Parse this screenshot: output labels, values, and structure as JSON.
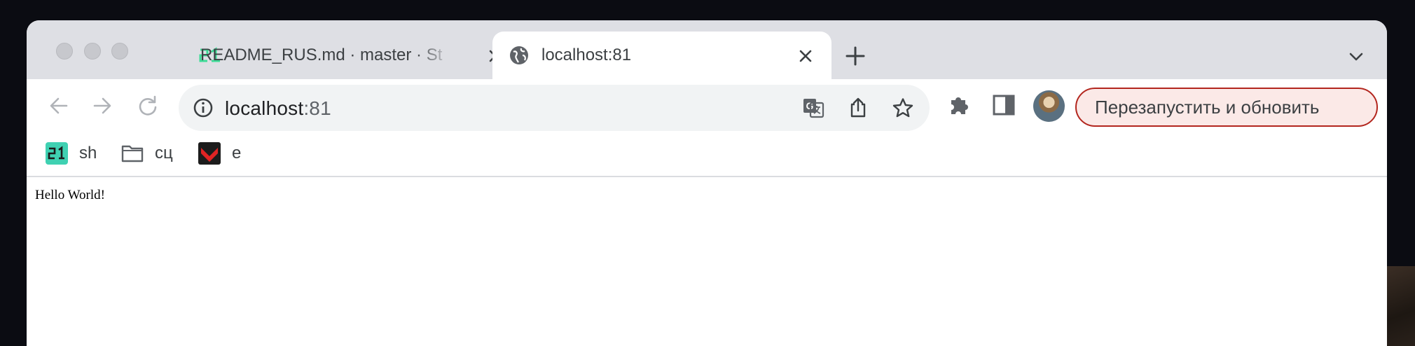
{
  "tabs": [
    {
      "title": "README_RUS.md · master · St",
      "favicon": "school21-icon",
      "close_icon": "close-icon",
      "active": false
    },
    {
      "title": "localhost:81",
      "favicon": "globe-icon",
      "close_icon": "close-icon",
      "active": true
    }
  ],
  "new_tab_icon": "plus-icon",
  "tab_search_icon": "chevron-down-icon",
  "toolbar": {
    "back_icon": "back-arrow-icon",
    "forward_icon": "forward-arrow-icon",
    "reload_icon": "reload-icon",
    "site_info_icon": "info-icon",
    "url_host": "localhost",
    "url_port": ":81",
    "translate_icon": "translate-icon",
    "share_icon": "share-icon",
    "bookmark_icon": "star-icon",
    "extensions_icon": "puzzle-icon",
    "side_panel_icon": "side-panel-icon",
    "relaunch_label": "Перезапустить и обновить",
    "relaunch_color": "#b3261e"
  },
  "bookmarks": [
    {
      "label": "sh",
      "icon": "school21-icon"
    },
    {
      "label": "сц",
      "icon": "folder-icon"
    },
    {
      "label": "e",
      "icon": "red-chevron-icon"
    }
  ],
  "content": {
    "text": "Hello World!"
  }
}
